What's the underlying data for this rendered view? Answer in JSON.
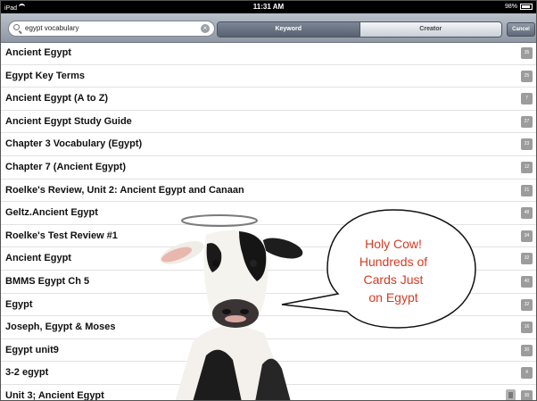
{
  "status_bar": {
    "device": "iPad",
    "time": "11:31 AM",
    "battery": "98%"
  },
  "search": {
    "query": "egypt vocabulary"
  },
  "segments": [
    "Keyword",
    "Creator"
  ],
  "cancel_label": "Cancel",
  "results": [
    {
      "title": "Ancient Egypt",
      "count": "35"
    },
    {
      "title": "Egypt Key Terms",
      "count": "25"
    },
    {
      "title": "Ancient Egypt (A to Z)",
      "count": "7"
    },
    {
      "title": "Ancient Egypt Study Guide",
      "count": "27"
    },
    {
      "title": "Chapter 3 Vocabulary (Egypt)",
      "count": "23"
    },
    {
      "title": "Chapter 7 (Ancient Egypt)",
      "count": "12"
    },
    {
      "title": "Roelke's Review, Unit 2: Ancient Egypt and Canaan",
      "count": "21"
    },
    {
      "title": "Geltz.Ancient Egypt",
      "count": "48"
    },
    {
      "title": "Roelke's Test Review #1",
      "count": "34"
    },
    {
      "title": "Ancient Egypt",
      "count": "32"
    },
    {
      "title": "BMMS Egypt Ch 5",
      "count": "40"
    },
    {
      "title": "Egypt",
      "count": "32"
    },
    {
      "title": "Joseph, Egypt & Moses",
      "count": "16"
    },
    {
      "title": "Egypt unit9",
      "count": "30"
    },
    {
      "title": "3-2 egypt",
      "count": "4"
    },
    {
      "title": "Unit 3; Ancient Egypt",
      "count": "30"
    }
  ],
  "callout": {
    "lines": [
      "Holy Cow!",
      "Hundreds of",
      "Cards Just",
      "on Egypt"
    ]
  },
  "colors": {
    "callout_text": "#d43b23",
    "status_bar": "#000000",
    "search_bar": "#a4adb8"
  }
}
